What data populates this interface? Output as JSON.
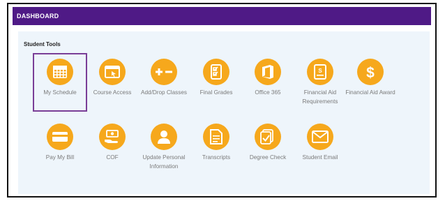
{
  "header": {
    "title": "DASHBOARD"
  },
  "section": {
    "title": "Student Tools"
  },
  "tools_row1": [
    {
      "label": "My Schedule",
      "icon": "calendar-icon",
      "selected": true
    },
    {
      "label": "Course Access",
      "icon": "browser-window-icon"
    },
    {
      "label": "Add/Drop Classes",
      "icon": "plus-minus-icon"
    },
    {
      "label": "Final Grades",
      "icon": "checklist-icon"
    },
    {
      "label": "Office 365",
      "icon": "office-logo-icon"
    },
    {
      "label": "Financial Aid Requirements",
      "icon": "document-icon"
    },
    {
      "label": "Financial Aid Award",
      "icon": "dollar-icon"
    }
  ],
  "tools_row2": [
    {
      "label": "Pay My Bill",
      "icon": "credit-card-icon"
    },
    {
      "label": "COF",
      "icon": "money-hand-icon"
    },
    {
      "label": "Update Personal Information",
      "icon": "person-icon"
    },
    {
      "label": "Transcripts",
      "icon": "transcript-icon"
    },
    {
      "label": "Degree Check",
      "icon": "degree-check-icon"
    },
    {
      "label": "Student Email",
      "icon": "envelope-icon"
    }
  ],
  "colors": {
    "header": "#4f1a86",
    "icon_bg": "#f6a81c",
    "panel_bg": "#eef5fb",
    "selection": "#7a3e97"
  }
}
